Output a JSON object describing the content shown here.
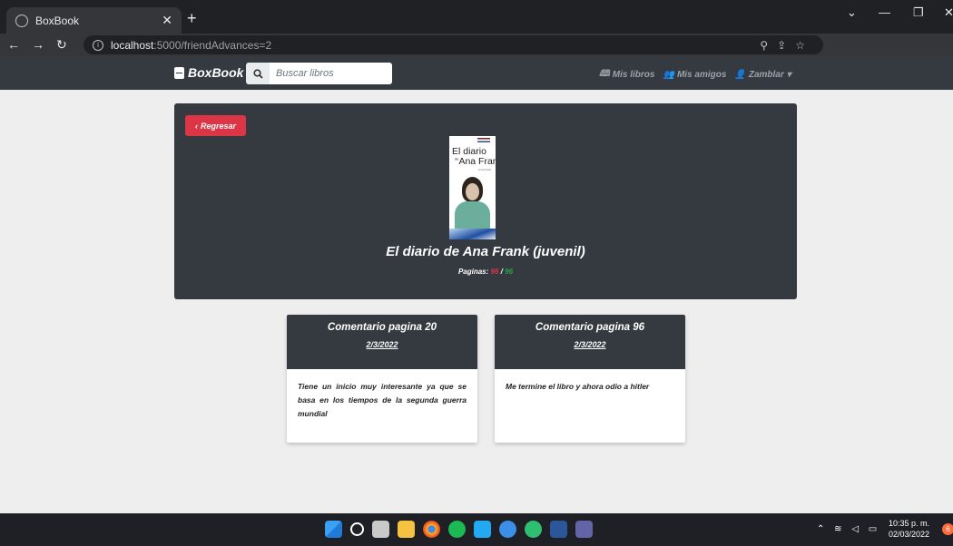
{
  "browser": {
    "tab_title": "BoxBook",
    "tab_close": "✕",
    "new_tab": "+",
    "url_host": "localhost",
    "url_rest": ":5000/friendAdvances=2",
    "minimize": "—",
    "restore": "❐",
    "close": "✕",
    "chevron": "⌄"
  },
  "navbar": {
    "brand": "BoxBook",
    "search_placeholder": "Buscar libros",
    "links": [
      "Mis libros",
      "Mis amigos",
      "Zamblar"
    ]
  },
  "hero": {
    "back_label": "Regresar",
    "back_icon": "‹",
    "cover": {
      "line1": "El diario",
      "line2": "de",
      "line3": "Ana Frank",
      "author": "Ana Frank"
    },
    "title": "El diario de Ana Frank (juvenil)",
    "pages_label": "Paginas:",
    "pages_read": "96",
    "pages_separator": "/",
    "pages_total": "96"
  },
  "comments": [
    {
      "title": "Comentario pagina 20",
      "date": "2/3/2022",
      "text": "Tiene un inicio muy interesante ya que se basa en los tiempos de la segunda guerra mundial"
    },
    {
      "title": "Comentario pagina 96",
      "date": "2/3/2022",
      "text": "Me termine el libro y ahora odio a hitler"
    }
  ],
  "taskbar": {
    "time": "10:35 p. m.",
    "date": "02/03/2022",
    "notifications": "6"
  },
  "colors": {
    "navbar": "#343a40",
    "danger": "#dc3545",
    "success": "#28a745",
    "page_bg": "#eeeeee"
  }
}
